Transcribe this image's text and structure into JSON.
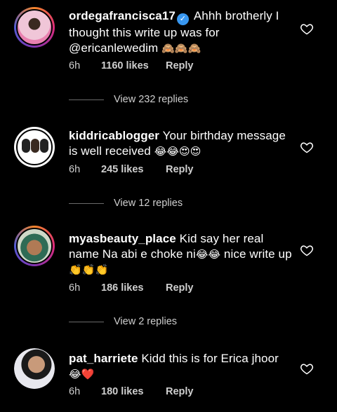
{
  "comments": [
    {
      "username": "ordegafrancisca17",
      "verified": true,
      "text": "Ahhh brotherly I thought this write up was for @ericanlewedim",
      "emojis": "🙈🙈🙈",
      "time": "6h",
      "likes": "1160 likes",
      "reply": "Reply",
      "view_replies": "View 232 replies"
    },
    {
      "username": "kiddricablogger",
      "verified": false,
      "text": "Your birthday message is well received",
      "emojis": "😂😂😍😍",
      "time": "6h",
      "likes": "245 likes",
      "reply": "Reply",
      "view_replies": "View 12 replies"
    },
    {
      "username": "myasbeauty_place",
      "verified": false,
      "text": "Kid say her real name Na abi e choke ni",
      "text_emojis": "😂😂",
      "text_after": "nice write up",
      "emojis": "👏👏👏",
      "time": "6h",
      "likes": "186 likes",
      "reply": "Reply",
      "view_replies": "View 2 replies"
    },
    {
      "username": "pat_harriete",
      "verified": false,
      "text": "Kidd this is for Erica jhoor",
      "emojis": "😂❤️",
      "time": "6h",
      "likes": "180 likes",
      "reply": "Reply"
    }
  ],
  "icons": {
    "like": "heart-outline-icon",
    "verified": "verified-badge-icon"
  },
  "colors": {
    "background": "#000000",
    "text": "#ffffff",
    "meta": "#cfcfcf",
    "verified": "#3897f0"
  }
}
